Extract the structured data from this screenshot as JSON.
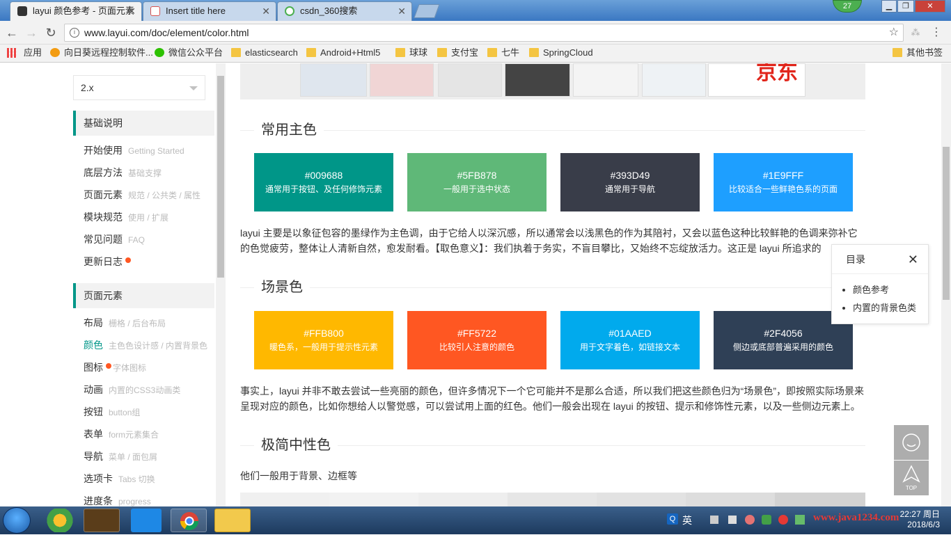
{
  "browser": {
    "tabs": [
      {
        "title": "layui 颜色参考 - 页面元素",
        "active": true,
        "favicon_color": "#333333"
      },
      {
        "title": "Insert title here",
        "active": false,
        "favicon_color": "#d9534f"
      },
      {
        "title": "csdn_360搜索",
        "active": false,
        "favicon_color": "#4caf50"
      }
    ],
    "user_badge": "27",
    "url": "www.layui.com/doc/element/color.html",
    "bookmarks": [
      {
        "label": "应用"
      },
      {
        "label": "向日葵远程控制软件..."
      },
      {
        "label": "微信公众平台"
      },
      {
        "label": "elasticsearch"
      },
      {
        "label": "Android+Html5"
      },
      {
        "label": "球球"
      },
      {
        "label": "支付宝"
      },
      {
        "label": "七牛"
      },
      {
        "label": "SpringCloud"
      },
      {
        "label": "其他书签"
      }
    ]
  },
  "sidebar": {
    "version": "2.x",
    "section1": "基础说明",
    "items1": [
      {
        "label": "开始使用",
        "sub": "Getting Started"
      },
      {
        "label": "底层方法",
        "sub": "基础支撑"
      },
      {
        "label": "页面元素",
        "sub": "规范 / 公共类 / 属性"
      },
      {
        "label": "模块规范",
        "sub": "使用 / 扩展"
      },
      {
        "label": "常见问题",
        "sub": "FAQ"
      },
      {
        "label": "更新日志",
        "sub": ""
      }
    ],
    "section2": "页面元素",
    "items2": [
      {
        "label": "布局",
        "sub": "栅格 / 后台布局"
      },
      {
        "label": "颜色",
        "sub": "主色色设计感 / 内置背景色"
      },
      {
        "label": "图标",
        "sub": "字体图标"
      },
      {
        "label": "动画",
        "sub": "内置的CSS3动画类"
      },
      {
        "label": "按钮",
        "sub": "button组"
      },
      {
        "label": "表单",
        "sub": "form元素集合"
      },
      {
        "label": "导航",
        "sub": "菜单 / 面包屑"
      },
      {
        "label": "选项卡",
        "sub": "Tabs 切换"
      },
      {
        "label": "进度条",
        "sub": "progress"
      }
    ]
  },
  "content": {
    "ad_text": "京东",
    "sections": [
      {
        "title": "常用主色",
        "swatches": [
          {
            "hex": "#009688",
            "desc": "通常用于按钮、及任何修饰元素",
            "color": "#009688"
          },
          {
            "hex": "#5FB878",
            "desc": "一般用于选中状态",
            "color": "#5FB878"
          },
          {
            "hex": "#393D49",
            "desc": "通常用于导航",
            "color": "#393D49"
          },
          {
            "hex": "#1E9FFF",
            "desc": "比较适合一些鲜艳色系的页面",
            "color": "#1E9FFF"
          }
        ],
        "paragraph": "layui 主要是以象征包容的墨绿作为主色调，由于它给人以深沉感，所以通常会以浅黑色的作为其陪衬，又会以蓝色这种比较鲜艳的色调来弥补它的色觉疲劳，整体让人清新自然，愈发耐看。【取色意义】：我们执着于务实，不盲目攀比，又始终不忘绽放活力。这正是 layui 所追求的"
      },
      {
        "title": "场景色",
        "swatches": [
          {
            "hex": "#FFB800",
            "desc": "暖色系，一般用于提示性元素",
            "color": "#FFB800"
          },
          {
            "hex": "#FF5722",
            "desc": "比较引人注意的颜色",
            "color": "#FF5722"
          },
          {
            "hex": "#01AAED",
            "desc": "用于文字着色，如链接文本",
            "color": "#01AAED"
          },
          {
            "hex": "#2F4056",
            "desc": "侧边或底部普遍采用的颜色",
            "color": "#2F4056"
          }
        ],
        "paragraph": "事实上，layui 并非不敢去尝试一些亮丽的颜色，但许多情况下一个它可能并不是那么合适，所以我们把这些颜色归为“场景色”，即按照实际场景来呈现对应的颜色，比如你想给人以警觉感，可以尝试用上面的红色。他们一般会出现在 layui 的按钮、提示和修饰性元素，以及一些侧边元素上。"
      },
      {
        "title": "极简中性色",
        "paragraph": "他们一般用于背景、边框等",
        "greys": [
          "#F0F0F0",
          "#F2F2F2",
          "#EEEEEE",
          "#E6E6E6",
          "#E2E2E2",
          "#DDDDDD",
          "#D2D2D2",
          "#C2C2C2"
        ]
      }
    ]
  },
  "toc": {
    "title": "目录",
    "items": [
      "颜色参考",
      "内置的背景色类"
    ]
  },
  "fixbar": {
    "top_label": "TOP"
  },
  "taskbar": {
    "ime": "英",
    "watermark": "www.java1234.com",
    "time": "22:27 周日",
    "date": "2018/6/3"
  }
}
